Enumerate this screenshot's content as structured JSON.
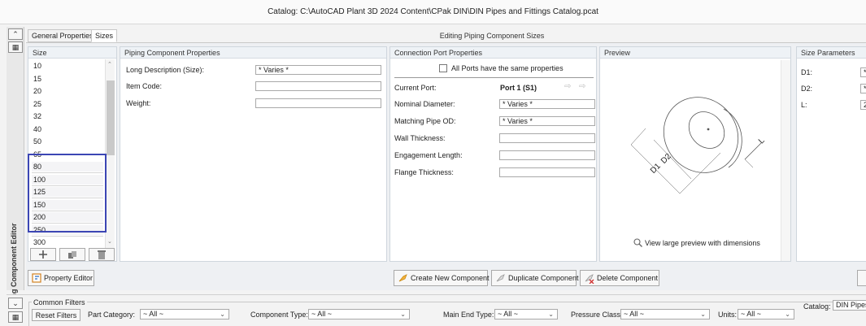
{
  "window": {
    "title": "Catalog: C:\\AutoCAD Plant 3D 2024 Content\\CPak DIN\\DIN Pipes and Fittings Catalog.pcat"
  },
  "tabs": [
    {
      "label": "General Properties"
    },
    {
      "label": "Sizes"
    }
  ],
  "editing_title": "Editing Piping Component Sizes",
  "side_label": "Piping Component Editor",
  "size_list": {
    "header": "Size",
    "items": [
      "10",
      "15",
      "20",
      "25",
      "32",
      "40",
      "50",
      "65",
      "80",
      "100",
      "125",
      "150",
      "200",
      "250",
      "300"
    ],
    "highlighted": [
      "80",
      "100",
      "125",
      "150",
      "200",
      "250"
    ],
    "highlight_color": "#3c46b4"
  },
  "component_props": {
    "header": "Piping Component Properties",
    "rows": [
      {
        "label": "Long Description (Size):",
        "value": "* Varies *"
      },
      {
        "label": "Item Code:",
        "value": ""
      },
      {
        "label": "Weight:",
        "value": ""
      }
    ]
  },
  "port_props": {
    "header": "Connection Port Properties",
    "all_ports_label": "All Ports have the same properties",
    "all_ports_checked": false,
    "current_port_label": "Current Port:",
    "current_port_value": "Port 1 (S1)",
    "rows": [
      {
        "label": "Nominal Diameter:",
        "value": "* Varies *"
      },
      {
        "label": "Matching Pipe OD:",
        "value": "* Varies *"
      },
      {
        "label": "Wall Thickness:",
        "value": ""
      },
      {
        "label": "Engagement Length:",
        "value": ""
      },
      {
        "label": "Flange Thickness:",
        "value": ""
      }
    ]
  },
  "preview": {
    "header": "Preview",
    "link": "View large preview with dimensions",
    "dims": {
      "d1": "D1",
      "d2": "D2",
      "l": "L"
    }
  },
  "size_params": {
    "header": "Size Parameters",
    "rows": [
      {
        "label": "D1:",
        "value": "*"
      },
      {
        "label": "D2:",
        "value": "*"
      },
      {
        "label": "L:",
        "value": "2"
      }
    ]
  },
  "actions": {
    "property_editor": "Property Editor",
    "create": "Create New Component",
    "duplicate": "Duplicate Component",
    "delete": "Delete Component"
  },
  "filters": {
    "group_label": "Common Filters",
    "reset": "Reset Filters",
    "part_category_label": "Part Category:",
    "part_category_value": "~ All ~",
    "component_type_label": "Component Type:",
    "component_type_value": "~ All ~",
    "main_end_type_label": "Main End Type:",
    "main_end_type_value": "~ All ~",
    "pressure_class_label": "Pressure Class:",
    "pressure_class_value": "~ All ~",
    "units_label": "Units:",
    "units_value": "~ All ~",
    "catalog_label": "Catalog:",
    "catalog_value": "DIN Pipes"
  },
  "icons": {
    "collapse_up": "double-chevron-up-icon",
    "collapse_down": "double-chevron-down-icon",
    "add": "plus-icon",
    "copy": "copy-icon",
    "delete": "trash-icon",
    "property_editor": "property-editor-icon",
    "create": "create-component-icon",
    "duplicate": "duplicate-component-icon",
    "delete_component": "delete-component-icon",
    "magnifier": "magnifier-icon",
    "port_prev": "arrow-left-icon",
    "port_next": "arrow-right-icon"
  }
}
